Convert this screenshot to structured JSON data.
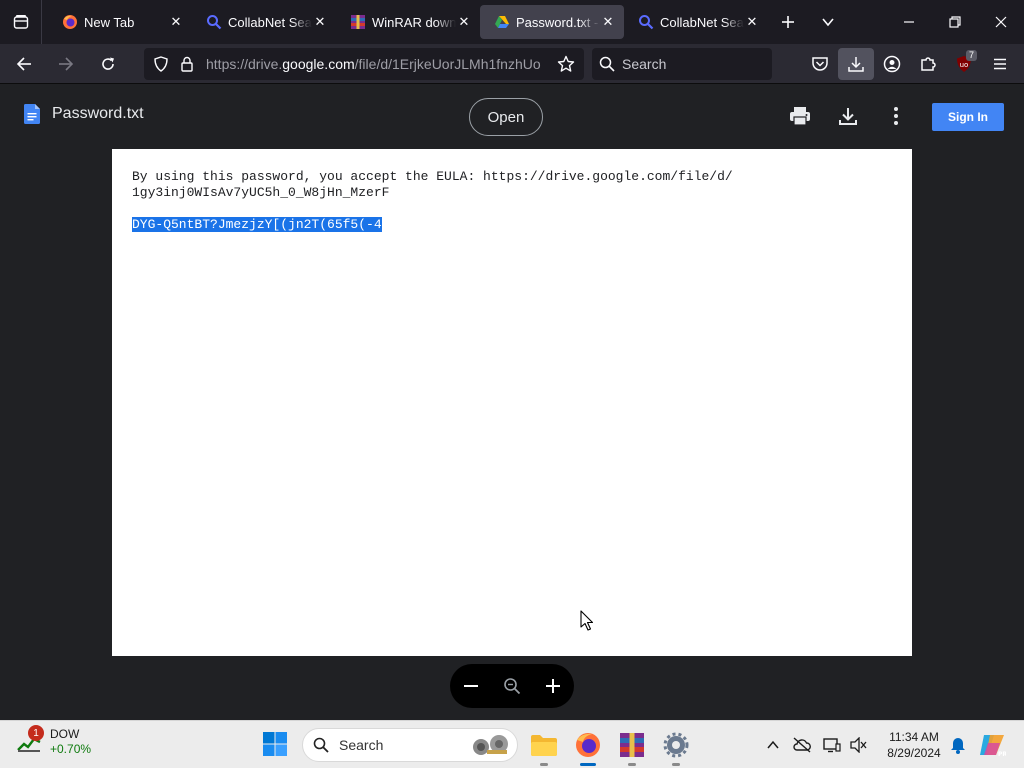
{
  "browser": {
    "tabs": [
      {
        "title": "New Tab",
        "icon": "firefox-icon",
        "active": false
      },
      {
        "title": "CollabNet SearX",
        "icon": "search-magnifier-icon",
        "active": false
      },
      {
        "title": "WinRAR download",
        "icon": "winrar-icon",
        "active": false
      },
      {
        "title": "Password.txt - Google Drive",
        "icon": "google-drive-icon",
        "active": true
      },
      {
        "title": "CollabNet SearX",
        "icon": "search-magnifier-icon",
        "active": false
      }
    ],
    "url_prefix": "https://drive.",
    "url_domain": "google.com",
    "url_rest": "/file/d/1ErjkeUorJLMh1fnzhUo",
    "search_placeholder": "Search",
    "extension_badge": "7"
  },
  "viewer": {
    "doc_title": "Password.txt",
    "open_label": "Open",
    "signin_label": "Sign In",
    "content": {
      "line1": "By using this password, you accept the EULA: https://drive.google.com/file/d/",
      "line2": "1gy3inj0WIsAv7yUC5h_0_W8jHn_MzerF",
      "password": "DYG-Q5ntBT?JmezjzY[(jn2T(65f5(-4"
    }
  },
  "taskbar": {
    "widget_title": "DOW",
    "widget_change": "+0.70%",
    "widget_badge": "1",
    "search_placeholder": "Search",
    "time": "11:34 AM",
    "date": "8/29/2024"
  },
  "colors": {
    "accent_blue": "#4285f4",
    "selection": "#1a73e8",
    "browser_dark": "#1c1b22"
  }
}
